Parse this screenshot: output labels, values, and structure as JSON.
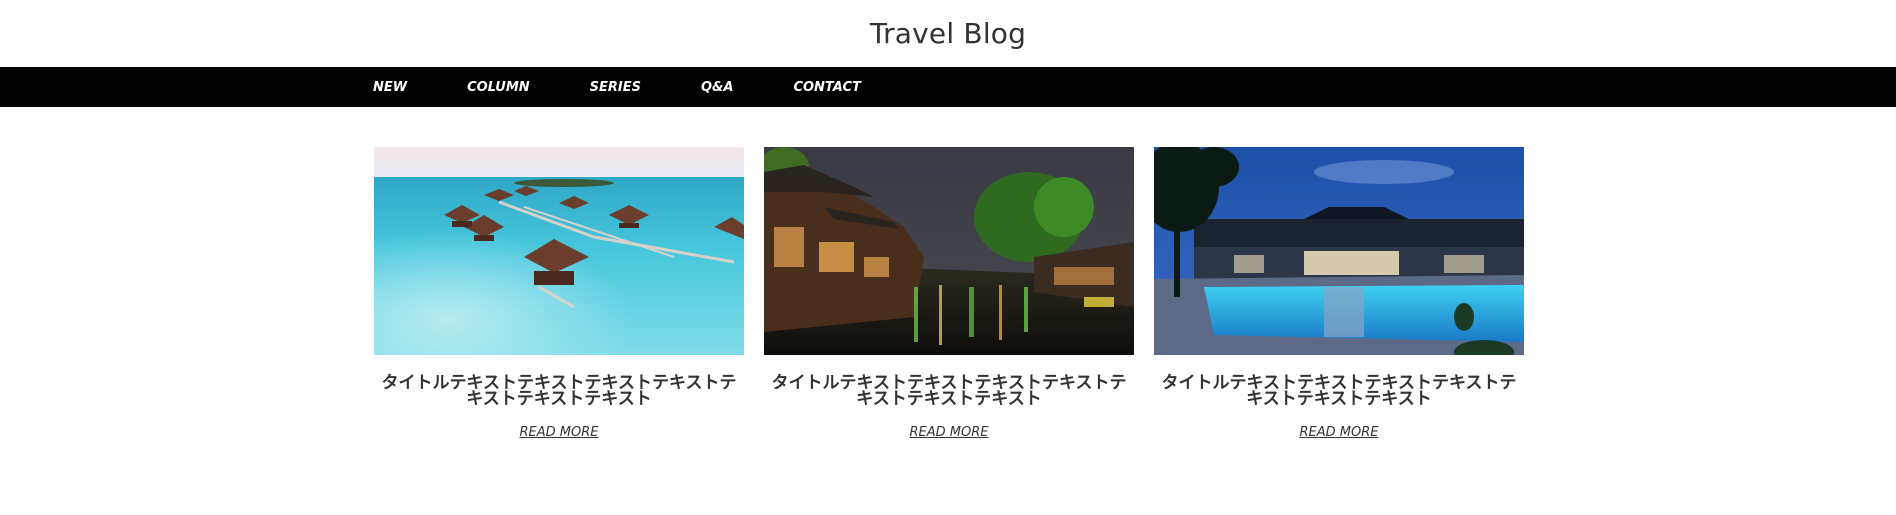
{
  "site": {
    "title": "Travel Blog"
  },
  "nav": {
    "items": [
      {
        "label": "NEW"
      },
      {
        "label": "COLUMN"
      },
      {
        "label": "SERIES"
      },
      {
        "label": "Q&A"
      },
      {
        "label": "CONTACT"
      }
    ]
  },
  "cards": [
    {
      "image": "maldives-overwater-villas-photo",
      "title": "タイトルテキストテキストテキストテキストテキストテキストテキスト",
      "link": "READ MORE"
    },
    {
      "image": "night-water-town-canal-photo",
      "title": "タイトルテキストテキストテキストテキストテキストテキストテキスト",
      "link": "READ MORE"
    },
    {
      "image": "resort-pool-at-dusk-photo",
      "title": "タイトルテキストテキストテキストテキストテキストテキストテキスト",
      "link": "READ MORE"
    }
  ],
  "colors": {
    "nav_background": "#000000",
    "nav_text": "#ffffff",
    "text": "#333333"
  }
}
